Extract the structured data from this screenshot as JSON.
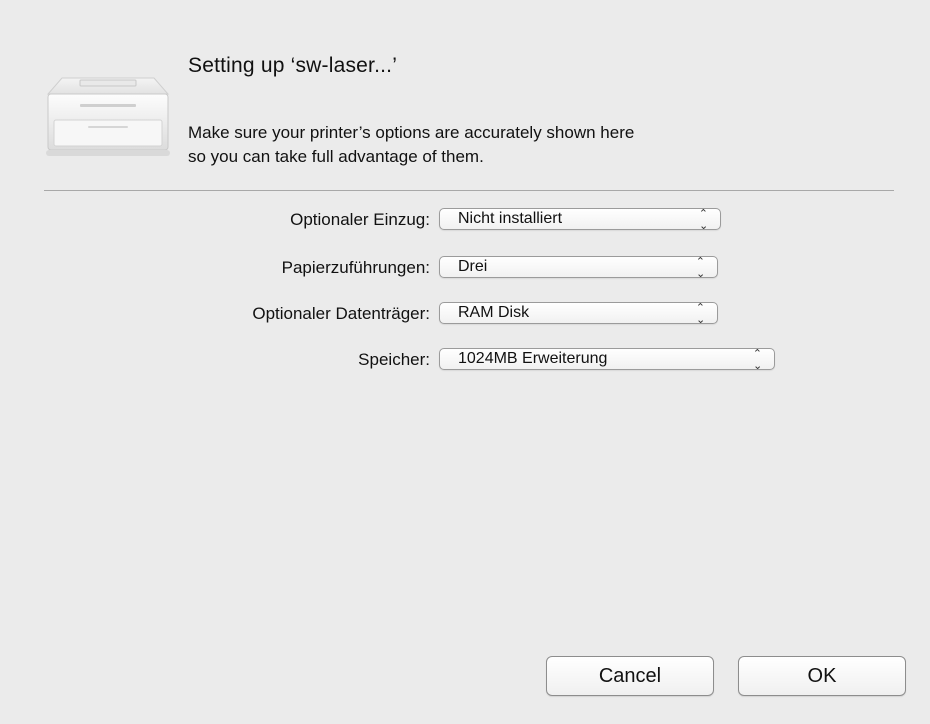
{
  "dialog": {
    "title": "Setting up ‘sw-laser...’",
    "message_line1": "Make sure your printer’s options are accurately shown here",
    "message_line2": "so you can take full advantage of them.",
    "icon": "printer-icon"
  },
  "options": [
    {
      "label": "Optionaler Einzug:",
      "value": "Nicht installiert"
    },
    {
      "label": "Papierzuführungen:",
      "value": "Drei"
    },
    {
      "label": "Optionaler Datenträger:",
      "value": "RAM Disk"
    },
    {
      "label": "Speicher:",
      "value": "1024MB Erweiterung"
    }
  ],
  "buttons": {
    "cancel": "Cancel",
    "ok": "OK"
  }
}
